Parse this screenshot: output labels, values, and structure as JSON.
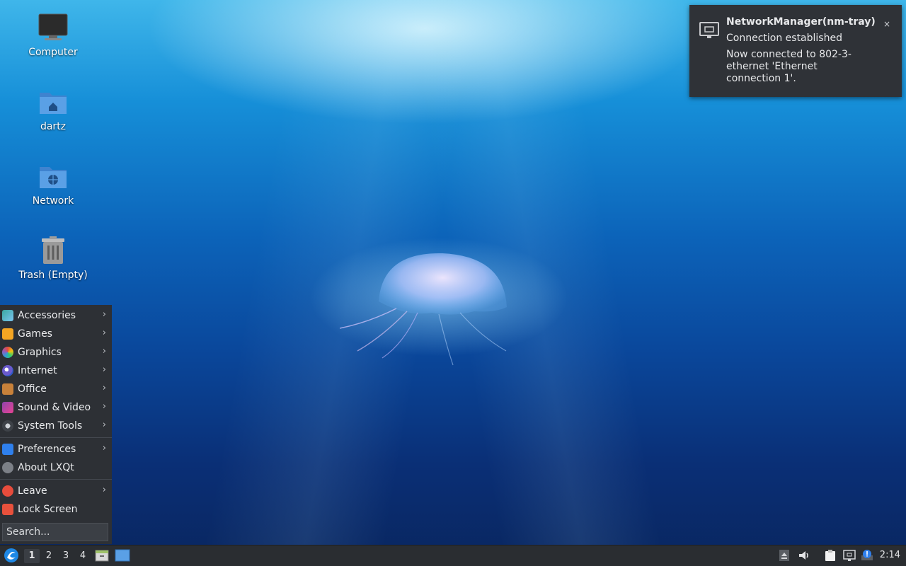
{
  "desktop": {
    "icons": [
      {
        "label": "Computer"
      },
      {
        "label": "dartz"
      },
      {
        "label": "Network"
      },
      {
        "label": "Trash (Empty)"
      }
    ]
  },
  "notification": {
    "title": "NetworkManager(nm-tray)",
    "summary": "Connection established",
    "body": "Now connected to 802-3-ethernet 'Ethernet connection 1'.",
    "close_label": "×"
  },
  "menu": {
    "items": [
      {
        "label": "Accessories"
      },
      {
        "label": "Games"
      },
      {
        "label": "Graphics"
      },
      {
        "label": "Internet"
      },
      {
        "label": "Office"
      },
      {
        "label": "Sound & Video"
      },
      {
        "label": "System Tools"
      },
      {
        "label": "Preferences"
      },
      {
        "label": "About LXQt"
      },
      {
        "label": "Leave"
      },
      {
        "label": "Lock Screen"
      }
    ],
    "submenu_arrow": "›",
    "search_placeholder": "Search..."
  },
  "taskbar": {
    "workspaces": [
      "1",
      "2",
      "3",
      "4"
    ],
    "active_workspace": "1",
    "clock": "2:14"
  },
  "colors": {
    "panel": "#2a2d31",
    "menu": "#2d3035",
    "notification": "#2f3237",
    "folder": "#4a90d9"
  }
}
